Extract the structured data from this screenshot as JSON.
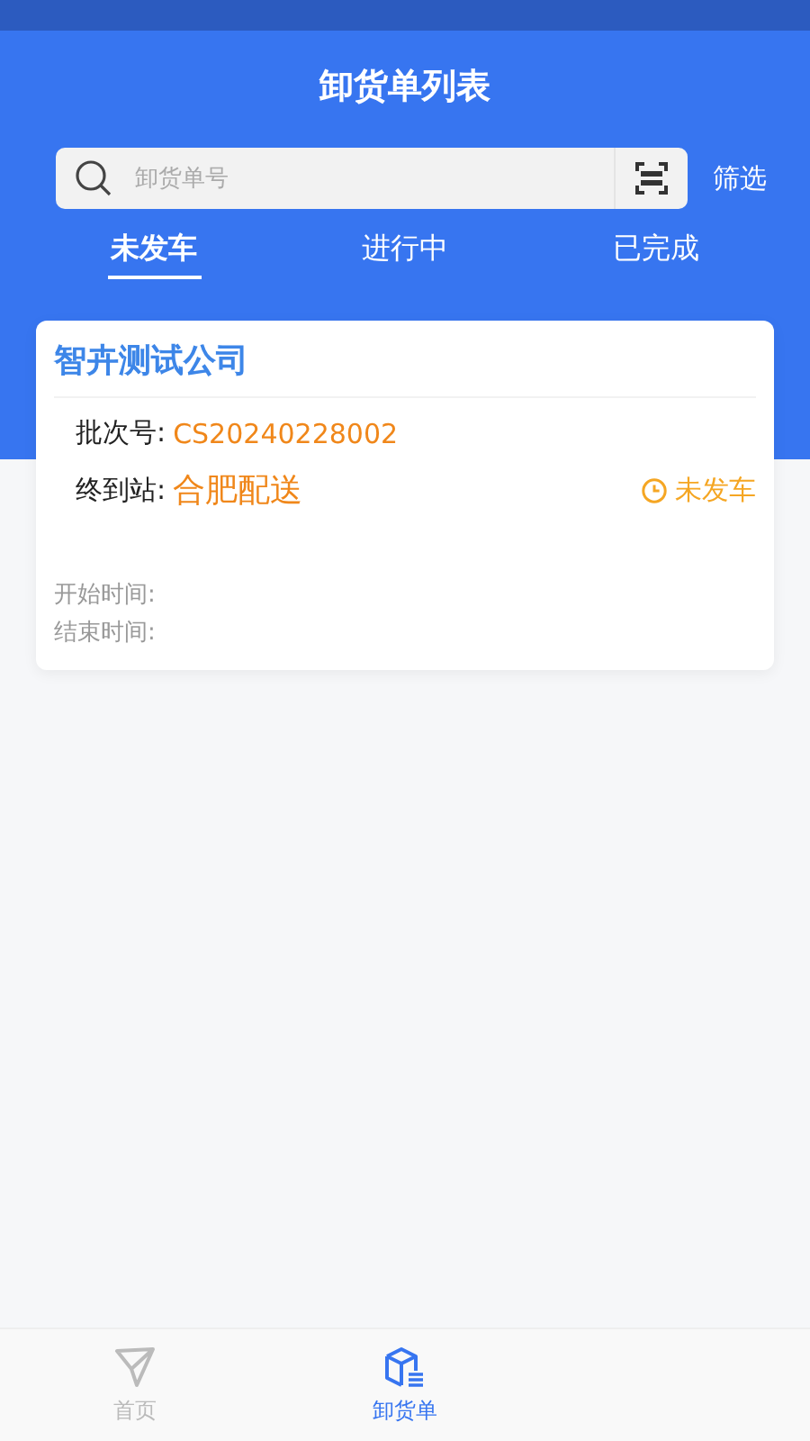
{
  "title": "卸货单列表",
  "search": {
    "placeholder": "卸货单号"
  },
  "filter_label": "筛选",
  "tabs": [
    {
      "label": "未发车",
      "selected": true
    },
    {
      "label": "进行中",
      "selected": false
    },
    {
      "label": "已完成",
      "selected": false
    }
  ],
  "orders": [
    {
      "company": "智卉测试公司",
      "batch_label": "批次号:",
      "batch_no": "CS20240228002",
      "station_label": "终到站:",
      "station": "合肥配送",
      "status": "未发车",
      "start_label": "开始时间:",
      "end_label": "结束时间:"
    }
  ],
  "nav": [
    {
      "label": "首页",
      "kind": "home",
      "selected": false
    },
    {
      "label": "卸货单",
      "kind": "box",
      "selected": true
    }
  ]
}
